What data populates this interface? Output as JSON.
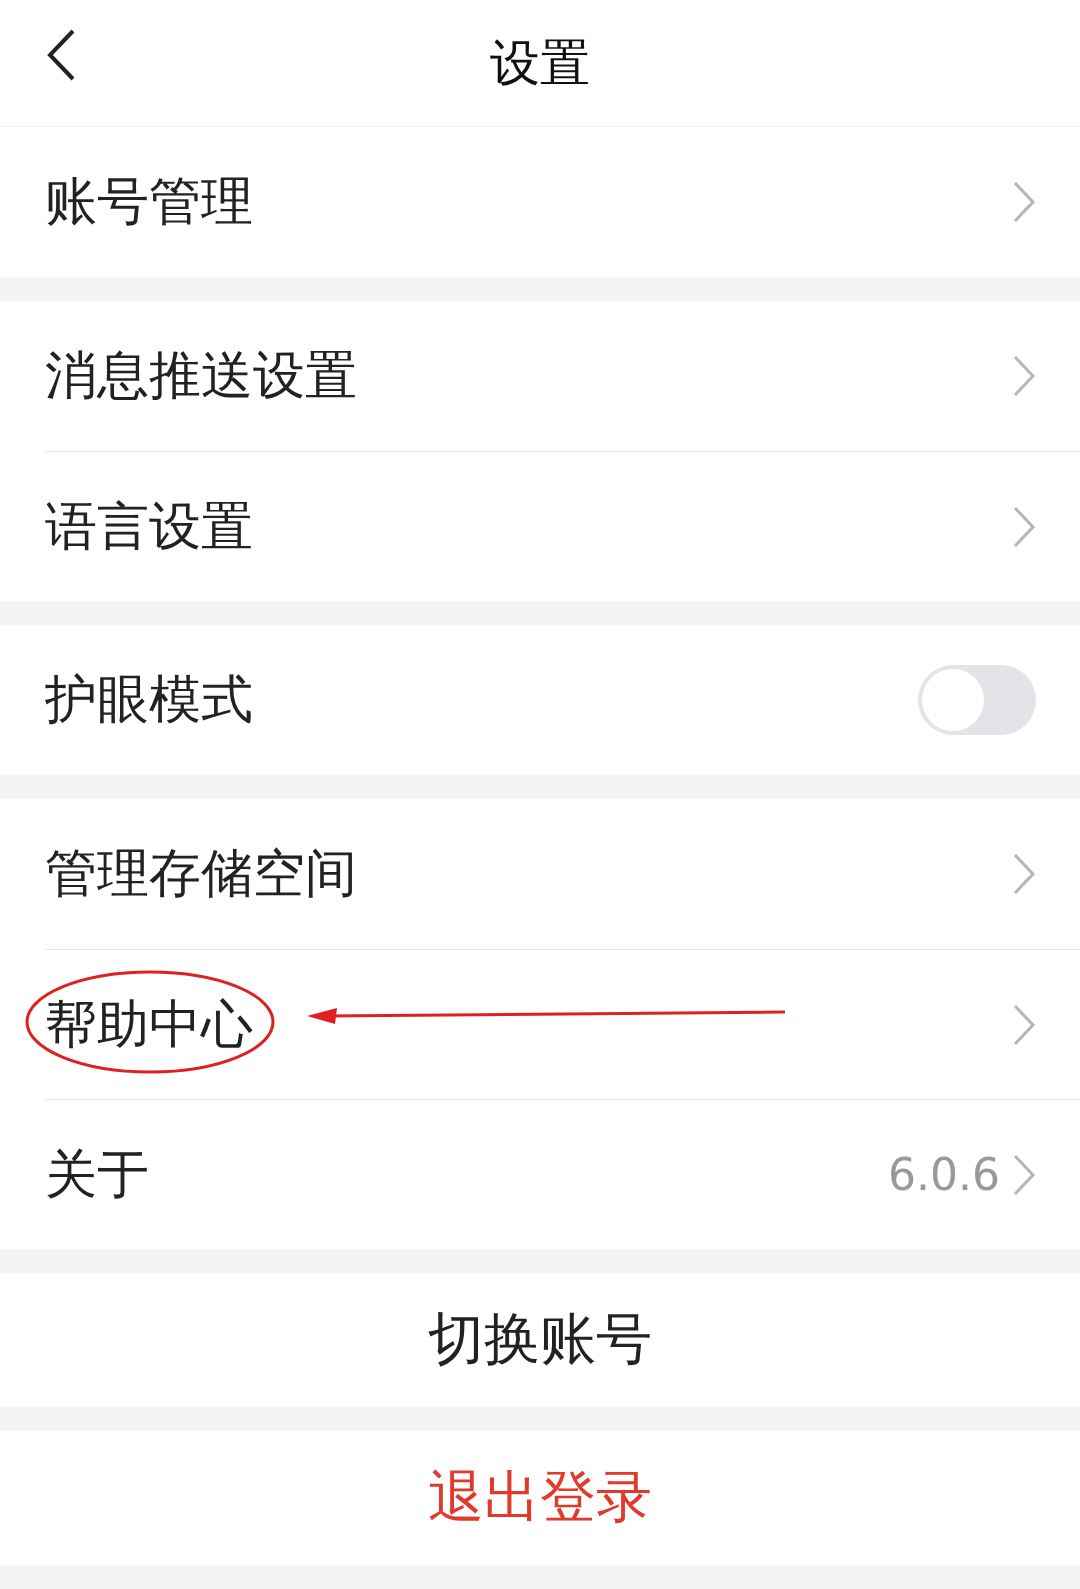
{
  "header": {
    "title": "设置"
  },
  "groups": [
    {
      "items": [
        {
          "label": "账号管理",
          "kind": "link",
          "highlighted": false
        }
      ]
    },
    {
      "items": [
        {
          "label": "消息推送设置",
          "kind": "link",
          "highlighted": false
        },
        {
          "label": "语言设置",
          "kind": "link",
          "highlighted": false
        }
      ]
    },
    {
      "items": [
        {
          "label": "护眼模式",
          "kind": "toggle",
          "on": false,
          "highlighted": false
        }
      ]
    },
    {
      "items": [
        {
          "label": "管理存储空间",
          "kind": "link",
          "highlighted": false
        },
        {
          "label": "帮助中心",
          "kind": "link",
          "highlighted": true
        },
        {
          "label": "关于",
          "kind": "value",
          "value": "6.0.6",
          "highlighted": false
        }
      ]
    }
  ],
  "actions": [
    {
      "label": "切换账号",
      "kind": "normal"
    },
    {
      "label": "退出登录",
      "kind": "danger"
    }
  ]
}
